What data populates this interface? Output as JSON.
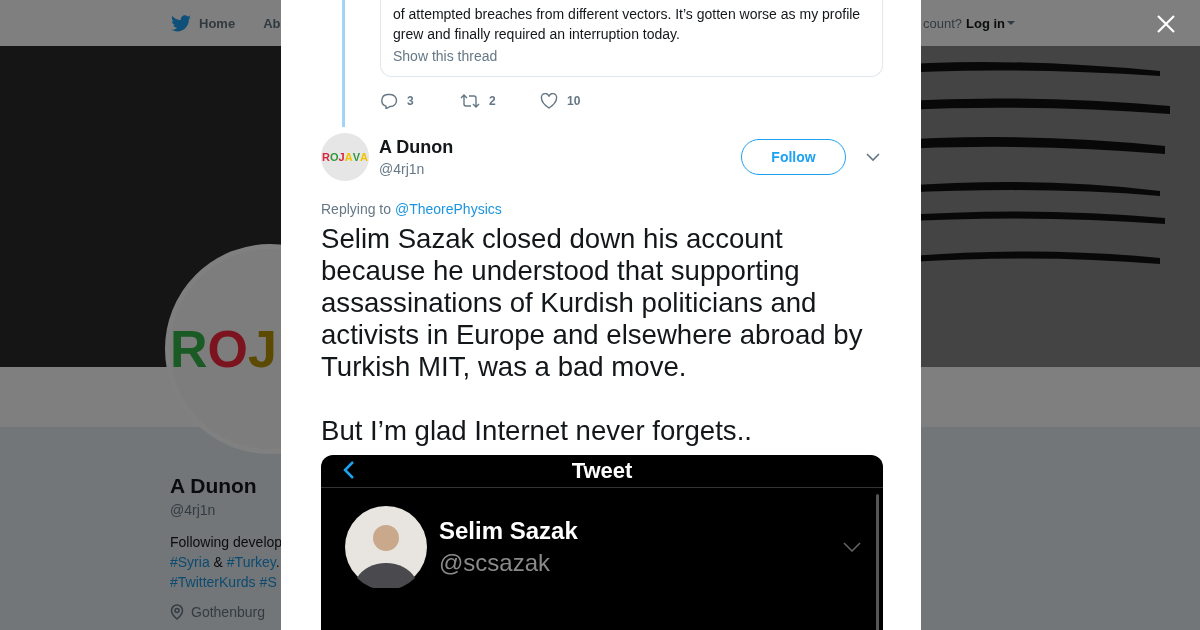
{
  "nav": {
    "items": [
      {
        "label": "Home",
        "selected": false
      },
      {
        "label": "Ab",
        "selected": false
      }
    ],
    "account_prompt": "count?",
    "login": "Log in"
  },
  "profile": {
    "avatar_letters": [
      {
        "char": "R",
        "color": "#1a5a25"
      },
      {
        "char": "O",
        "color": "#7c1420"
      },
      {
        "char": "J",
        "color": "#5c4a00"
      }
    ],
    "name": "A Dunon",
    "handle": "@4rj1n",
    "bio": [
      [
        {
          "text": "Following develop",
          "kind": "plain"
        }
      ],
      [
        {
          "text": "#Syria",
          "kind": "hashtag"
        },
        {
          "text": " & ",
          "kind": "plain"
        },
        {
          "text": "#Turkey",
          "kind": "hashtag"
        },
        {
          "text": ".",
          "kind": "plain"
        }
      ],
      [
        {
          "text": "#TwitterKurds",
          "kind": "hashtag"
        },
        {
          "text": "#S",
          "kind": "hashtag"
        }
      ]
    ],
    "location": "Gothenburg"
  },
  "modal": {
    "parent_tweet": {
      "quote_text": "of attempted breaches from different vectors. It’s gotten worse as my profile grew and finally required an interruption today.",
      "show_thread": "Show this thread",
      "replies": "3",
      "retweets": "2",
      "likes": "10"
    },
    "tweet": {
      "avatar_letters": [
        {
          "char": "R",
          "color": "#d7263d"
        },
        {
          "char": "O",
          "color": "#2e9a3e"
        },
        {
          "char": "J",
          "color": "#d7263d"
        },
        {
          "char": "A",
          "color": "#f2c200"
        },
        {
          "char": "V",
          "color": "#2e9a3e"
        },
        {
          "char": "A",
          "color": "#f2c200"
        }
      ],
      "name": "A Dunon",
      "handle": "@4rj1n",
      "follow": "Follow",
      "replying_label": "Replying to",
      "replying_to": "@TheorePhysics",
      "paragraphs": [
        "Selim Sazak closed down his account because he understood that supporting assassinations of Kurdish politicians and activists in Europe and elsewhere abroad by Turkish MIT, was a bad move.",
        "But I’m glad Internet never forgets.."
      ],
      "media": {
        "header_title": "Tweet",
        "name": "Selim Sazak",
        "handle": "@scsazak"
      }
    }
  }
}
